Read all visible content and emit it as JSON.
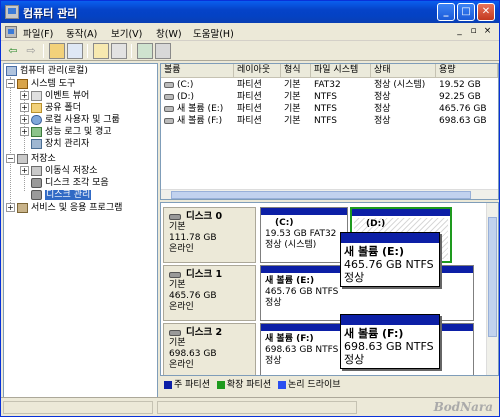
{
  "window": {
    "title": "컴퓨터 관리"
  },
  "titlebar": {
    "min": "_",
    "max": "□",
    "close": "✕"
  },
  "menu": {
    "items": [
      "파일(F)",
      "동작(A)",
      "보기(V)",
      "창(W)",
      "도움말(H)"
    ],
    "mdi_min": "_",
    "mdi_restore": "▫",
    "mdi_close": "×"
  },
  "toolbar": {
    "back": "⇦",
    "forward": "⇨"
  },
  "tree": {
    "root": "컴퓨터 관리(로컬)",
    "system_tools": "시스템 도구",
    "event_viewer": "이벤트 뷰어",
    "shared_folders": "공유 폴더",
    "local_users": "로컬 사용자 및 그룹",
    "perf_logs": "성능 로그 및 경고",
    "device_manager": "장치 관리자",
    "storage": "저장소",
    "removable": "이동식 저장소",
    "defrag": "디스크 조각 모음",
    "disk_mgmt": "디스크 관리",
    "services": "서비스 및 응용 프로그램",
    "plus": "+",
    "minus": "−"
  },
  "volumes": {
    "headers": [
      "볼륨",
      "레이아웃",
      "형식",
      "파일 시스템",
      "상태",
      "용량"
    ],
    "rows": [
      [
        "(C:)",
        "파티션",
        "기본",
        "FAT32",
        "정상 (시스템)",
        "19.52 GB"
      ],
      [
        "(D:)",
        "파티션",
        "기본",
        "NTFS",
        "정상",
        "92.25 GB"
      ],
      [
        "새 볼륨 (E:)",
        "파티션",
        "기본",
        "NTFS",
        "정상",
        "465.76 GB"
      ],
      [
        "새 볼륨 (F:)",
        "파티션",
        "기본",
        "NTFS",
        "정상",
        "698.63 GB"
      ]
    ]
  },
  "disks": [
    {
      "name": "디스크 0",
      "type": "기본",
      "size": "111.78 GB",
      "status": "온라인",
      "partitions": [
        {
          "name": "(C:)",
          "line1": "19.53 GB FAT32",
          "line2": "정상 (시스템)"
        },
        {
          "name": "(D:)",
          "line1": "",
          "line2": ""
        }
      ]
    },
    {
      "name": "디스크 1",
      "type": "기본",
      "size": "465.76 GB",
      "status": "온라인",
      "partitions": [
        {
          "name": "새 볼륨 (E:)",
          "line1": "465.76 GB NTFS",
          "line2": "정상"
        }
      ]
    },
    {
      "name": "디스크 2",
      "type": "기본",
      "size": "698.63 GB",
      "status": "온라인",
      "partitions": [
        {
          "name": "새 볼륨 (F:)",
          "line1": "698.63 GB NTFS",
          "line2": "정상"
        }
      ]
    }
  ],
  "popups": [
    {
      "name": "새 볼륨 (E:)",
      "line1": "465.76 GB NTFS",
      "line2": "정상"
    },
    {
      "name": "새 볼륨 (F:)",
      "line1": "698.63 GB NTFS",
      "line2": "정상"
    }
  ],
  "legend": [
    {
      "label": "주 파티션",
      "color": "#0c1fa6"
    },
    {
      "label": "확장 파티션",
      "color": "#1e9a1e"
    },
    {
      "label": "논리 드라이브",
      "color": "#2a4ef0"
    }
  ],
  "watermark": "BodNara"
}
